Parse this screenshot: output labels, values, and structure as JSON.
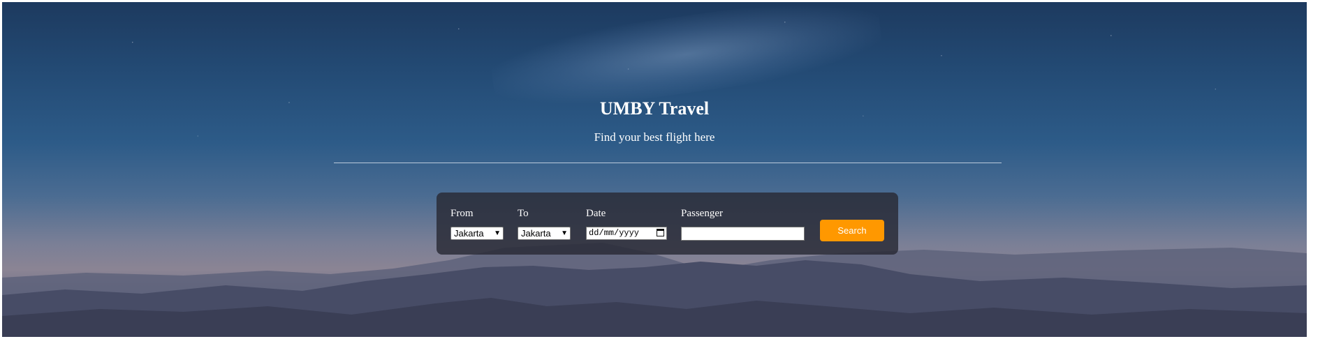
{
  "header": {
    "title": "UMBY Travel",
    "subtitle": "Find your best flight here"
  },
  "form": {
    "from": {
      "label": "From",
      "value": "Jakarta"
    },
    "to": {
      "label": "To",
      "value": "Jakarta"
    },
    "date": {
      "label": "Date",
      "placeholder": "dd/mm/yyyy"
    },
    "passenger": {
      "label": "Passenger",
      "value": ""
    },
    "search_label": "Search"
  },
  "colors": {
    "button": "#ff9800",
    "panel": "#28293a",
    "text": "#ffffff"
  },
  "icons": {
    "select_arrow": "chevron-down-icon",
    "date_picker": "calendar-icon"
  }
}
